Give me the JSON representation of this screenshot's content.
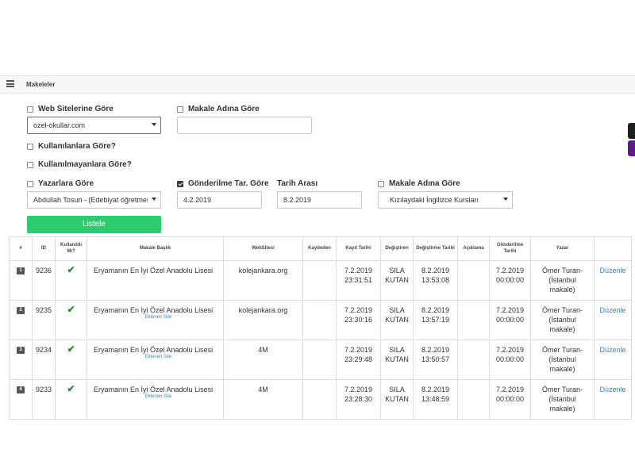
{
  "panel": {
    "title": "Makeleler"
  },
  "filters": {
    "web_sites_label": "Web Sitelerine Göre",
    "web_site_value": "ozel-okullar.com",
    "article_name_label": "Makale Adına Göre",
    "article_name_value": "",
    "by_users_label": "Kullanılanlara Göre?",
    "by_unused_label": "Kullanılmayanlara Göre?",
    "authors_label": "Yazarlara Göre",
    "author_value": "Abdullah Tosun - (Edebiyat öğretmeni)",
    "sent_date_label": "Gönderilme Tar. Göre",
    "date_range_label": "Tarih Arası",
    "date_from": "4.2.2019",
    "date_to": "8.2.2019",
    "article_name2_label": "Makale Adına Göre",
    "article_name2_value": "Kızılaydaki İngilizce Kursları",
    "list_button": "Listele"
  },
  "table": {
    "headers": [
      "#",
      "ID",
      "Kullanıldı Mı?",
      "Makale Başlık",
      "WebSitesi",
      "Kaydeden",
      "Kayıt Tarihi",
      "Değiştiren",
      "Değiştirme Tarihi",
      "Açıklama",
      "Gönderilme Tarihi",
      "Yazar",
      ""
    ],
    "rows": [
      {
        "no": "1",
        "id": "9236",
        "used": "✔",
        "title": "Eryamanın En İyi Özel Anadolu Lisesi",
        "sub": "",
        "site": "kolejankara.org",
        "saved_by": "",
        "reg_date": "7.2.2019",
        "reg_time": "23:31:51",
        "changer1": "SILA",
        "changer2": "KUTAN",
        "chg_date": "8.2.2019",
        "chg_time": "13:53:08",
        "desc": "",
        "sent_date": "7.2.2019",
        "sent_time": "00:00:00",
        "author1": "Ömer Turan-",
        "author2": "(İstanbul",
        "author3": "makale)",
        "action": "Düzenle"
      },
      {
        "no": "2",
        "id": "9235",
        "used": "✔",
        "title": "Eryamanın En İyi Özel Anadolu Lisesi",
        "sub": "Eklenen Site",
        "site": "kolejankara.org",
        "saved_by": "",
        "reg_date": "7.2.2019",
        "reg_time": "23:30:16",
        "changer1": "SILA",
        "changer2": "KUTAN",
        "chg_date": "8.2.2019",
        "chg_time": "13:57:19",
        "desc": "",
        "sent_date": "7.2.2019",
        "sent_time": "00:00:00",
        "author1": "Ömer Turan-",
        "author2": "(İstanbul",
        "author3": "makale)",
        "action": "Düzenle"
      },
      {
        "no": "3",
        "id": "9234",
        "used": "✔",
        "title": "Eryamanın En İyi Özel Anadolu Lisesi",
        "sub": "Eklenen Site",
        "site": "4M",
        "saved_by": "",
        "reg_date": "7.2.2019",
        "reg_time": "23:29:48",
        "changer1": "SILA",
        "changer2": "KUTAN",
        "chg_date": "8.2.2019",
        "chg_time": "13:50:57",
        "desc": "",
        "sent_date": "7.2.2019",
        "sent_time": "00:00:00",
        "author1": "Ömer Turan-",
        "author2": "(İstanbul",
        "author3": "makale)",
        "action": "Düzenle"
      },
      {
        "no": "4",
        "id": "9233",
        "used": "✔",
        "title": "Eryamanın En İyi Özel Anadolu Lisesi",
        "sub": "Eklenen Site",
        "site": "4M",
        "saved_by": "",
        "reg_date": "7.2.2019",
        "reg_time": "23:28:30",
        "changer1": "SILA",
        "changer2": "KUTAN",
        "chg_date": "8.2.2019",
        "chg_time": "13:48:59",
        "desc": "",
        "sent_date": "7.2.2019",
        "sent_time": "00:00:00",
        "author1": "Ömer Turan-",
        "author2": "(İstanbul",
        "author3": "makale)",
        "action": "Düzenle"
      }
    ]
  }
}
